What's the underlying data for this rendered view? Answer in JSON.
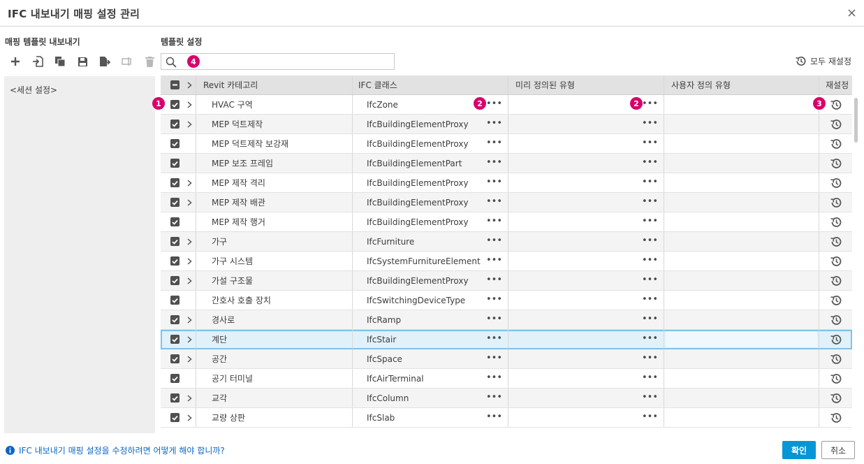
{
  "window": {
    "title": "IFC 내보내기 매핑 설정 관리"
  },
  "left_panel": {
    "title": "매핑 템플릿 내보내기",
    "toolbar_icons": [
      "add-icon",
      "import-icon",
      "copy-icon",
      "save-icon",
      "export-icon",
      "rename-icon",
      "delete-icon"
    ],
    "items": [
      {
        "label": "<세션 설정>"
      }
    ]
  },
  "right_panel": {
    "title": "템플릿 설정",
    "search": {
      "value": "",
      "placeholder": ""
    },
    "reset_all_label": "모두 재설정"
  },
  "badges": {
    "checkbox": "1",
    "ellipsis": "2",
    "reset": "3",
    "search": "4"
  },
  "table": {
    "headers": {
      "category": "Revit 카테고리",
      "ifc_class": "IFC 클래스",
      "predefined": "미리 정의된 유형",
      "user_defined": "사용자 정의 유형",
      "reset": "재설정"
    },
    "rows": [
      {
        "category": "HVAC 구역",
        "ifc_class": "IfcZone",
        "checked": true,
        "expandable": true,
        "selected": false
      },
      {
        "category": "MEP 덕트제작",
        "ifc_class": "IfcBuildingElementProxy",
        "checked": true,
        "expandable": true,
        "selected": false
      },
      {
        "category": "MEP 덕트제작 보강재",
        "ifc_class": "IfcBuildingElementProxy",
        "checked": true,
        "expandable": false,
        "selected": false
      },
      {
        "category": "MEP 보조 프레임",
        "ifc_class": "IfcBuildingElementPart",
        "checked": true,
        "expandable": false,
        "selected": false
      },
      {
        "category": "MEP 제작 격리",
        "ifc_class": "IfcBuildingElementProxy",
        "checked": true,
        "expandable": true,
        "selected": false
      },
      {
        "category": "MEP 제작 배관",
        "ifc_class": "IfcBuildingElementProxy",
        "checked": true,
        "expandable": true,
        "selected": false
      },
      {
        "category": "MEP 제작 행거",
        "ifc_class": "IfcBuildingElementProxy",
        "checked": true,
        "expandable": false,
        "selected": false
      },
      {
        "category": "가구",
        "ifc_class": "IfcFurniture",
        "checked": true,
        "expandable": true,
        "selected": false
      },
      {
        "category": "가구 시스템",
        "ifc_class": "IfcSystemFurnitureElement",
        "checked": true,
        "expandable": true,
        "selected": false
      },
      {
        "category": "가설 구조물",
        "ifc_class": "IfcBuildingElementProxy",
        "checked": true,
        "expandable": true,
        "selected": false
      },
      {
        "category": "간호사 호출 장치",
        "ifc_class": "IfcSwitchingDeviceType",
        "checked": true,
        "expandable": false,
        "selected": false
      },
      {
        "category": "경사로",
        "ifc_class": "IfcRamp",
        "checked": true,
        "expandable": true,
        "selected": false
      },
      {
        "category": "계단",
        "ifc_class": "IfcStair",
        "checked": true,
        "expandable": true,
        "selected": true
      },
      {
        "category": "공간",
        "ifc_class": "IfcSpace",
        "checked": true,
        "expandable": true,
        "selected": false
      },
      {
        "category": "공기 터미널",
        "ifc_class": "IfcAirTerminal",
        "checked": true,
        "expandable": false,
        "selected": false
      },
      {
        "category": "교각",
        "ifc_class": "IfcColumn",
        "checked": true,
        "expandable": true,
        "selected": false
      },
      {
        "category": "교량 상판",
        "ifc_class": "IfcSlab",
        "checked": true,
        "expandable": true,
        "selected": false
      }
    ]
  },
  "footer": {
    "help_text": "IFC 내보내기 매핑 설정을 수정하려면 어떻게 해야 합니까?",
    "ok_label": "확인",
    "cancel_label": "취소"
  },
  "colors": {
    "accent": "#0696d7",
    "badge": "#d8006b",
    "link": "#0a67c5",
    "selection": "#e1f1fa"
  }
}
